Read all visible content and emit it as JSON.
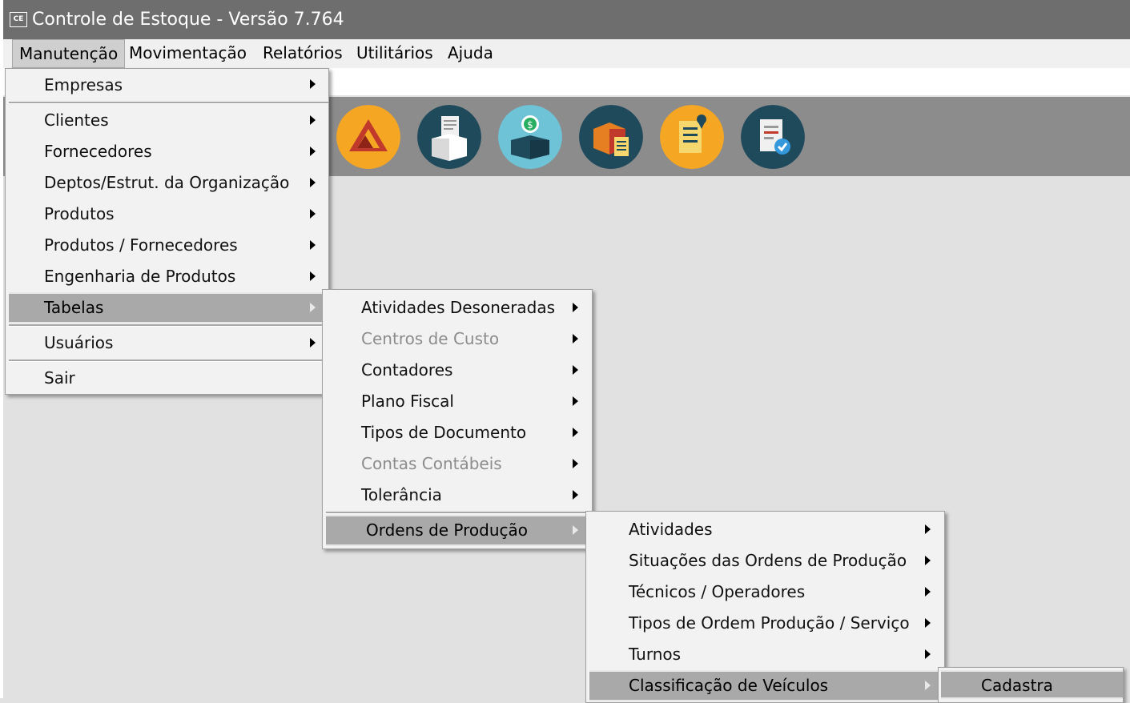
{
  "window": {
    "icon_text": "CE",
    "title": "Controle de Estoque - Versão 7.764"
  },
  "menubar": [
    {
      "label": "Manutenção",
      "active": true
    },
    {
      "label": "Movimentação"
    },
    {
      "label": "Relatórios"
    },
    {
      "label": "Utilitários"
    },
    {
      "label": "Ajuda"
    }
  ],
  "toolbar_icons": [
    {
      "name": "logo-triangle-icon",
      "color": "#f5a623"
    },
    {
      "name": "document-box-icon",
      "color": "#1f4a5c"
    },
    {
      "name": "money-box-icon",
      "color": "#6fc3d6"
    },
    {
      "name": "package-list-icon",
      "color": "#1f4a5c"
    },
    {
      "name": "checklist-pin-icon",
      "color": "#f5a623"
    },
    {
      "name": "clipboard-check-icon",
      "color": "#1f4a5c"
    }
  ],
  "menu_manutencao": {
    "items": [
      {
        "label": "Empresas",
        "submenu": true
      },
      {
        "label": "Clientes",
        "submenu": true
      },
      {
        "label": "Fornecedores",
        "submenu": true
      },
      {
        "label": "Deptos/Estrut. da Organização",
        "submenu": true
      },
      {
        "label": "Produtos",
        "submenu": true
      },
      {
        "label": "Produtos / Fornecedores",
        "submenu": true
      },
      {
        "label": "Engenharia de Produtos",
        "submenu": true
      },
      {
        "label": "Tabelas",
        "submenu": true,
        "highlight": true
      },
      {
        "label": "Usuários",
        "submenu": true
      },
      {
        "label": "Sair"
      }
    ]
  },
  "menu_tabelas": {
    "items": [
      {
        "label": "Atividades Desoneradas",
        "submenu": true
      },
      {
        "label": "Centros de Custo",
        "submenu": true,
        "disabled": true
      },
      {
        "label": "Contadores",
        "submenu": true
      },
      {
        "label": "Plano Fiscal",
        "submenu": true
      },
      {
        "label": "Tipos de Documento",
        "submenu": true
      },
      {
        "label": "Contas Contábeis",
        "submenu": true,
        "disabled": true
      },
      {
        "label": "Tolerância",
        "submenu": true
      },
      {
        "label": "Ordens de Produção",
        "submenu": true,
        "highlight": true
      }
    ]
  },
  "menu_ordens": {
    "items": [
      {
        "label": "Atividades",
        "submenu": true
      },
      {
        "label": "Situações das Ordens de Produção",
        "submenu": true
      },
      {
        "label": "Técnicos / Operadores",
        "submenu": true
      },
      {
        "label": "Tipos de Ordem Produção / Serviço",
        "submenu": true
      },
      {
        "label": "Turnos",
        "submenu": true
      },
      {
        "label": "Classificação de Veículos",
        "submenu": true,
        "highlight": true
      }
    ]
  },
  "menu_classificacao": {
    "items": [
      {
        "label": "Cadastra"
      }
    ]
  }
}
